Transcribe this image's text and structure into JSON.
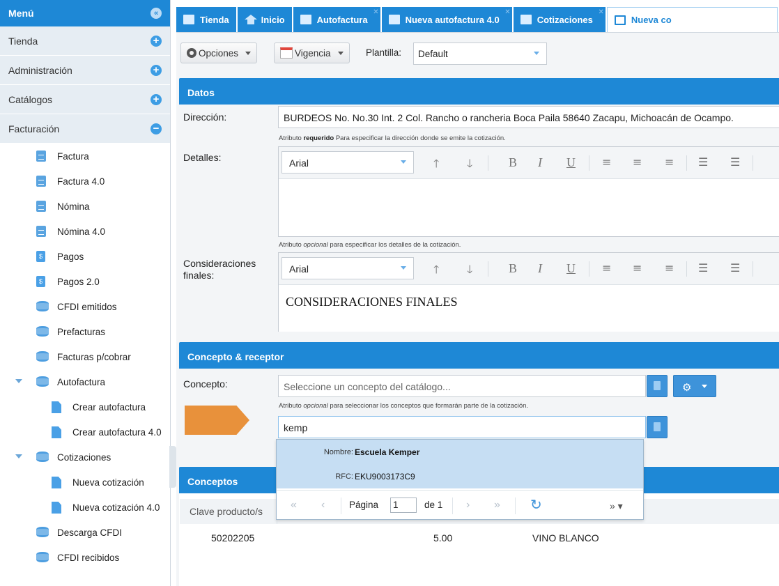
{
  "sidebar": {
    "title": "Menú",
    "sections": [
      {
        "label": "Tienda"
      },
      {
        "label": "Administración"
      },
      {
        "label": "Catálogos"
      },
      {
        "label": "Facturación"
      }
    ],
    "items": [
      {
        "label": "Factura"
      },
      {
        "label": "Factura 4.0"
      },
      {
        "label": "Nómina"
      },
      {
        "label": "Nómina 4.0"
      },
      {
        "label": "Pagos"
      },
      {
        "label": "Pagos 2.0"
      },
      {
        "label": "CFDI emitidos"
      },
      {
        "label": "Prefacturas"
      },
      {
        "label": "Facturas p/cobrar"
      },
      {
        "label": "Autofactura"
      },
      {
        "label": "Crear autofactura"
      },
      {
        "label": "Crear autofactura 4.0"
      },
      {
        "label": "Cotizaciones"
      },
      {
        "label": "Nueva cotización"
      },
      {
        "label": "Nueva cotización 4.0"
      },
      {
        "label": "Descarga CFDI"
      },
      {
        "label": "CFDI recibidos"
      }
    ]
  },
  "tabs": [
    {
      "label": "Tienda"
    },
    {
      "label": "Inicio"
    },
    {
      "label": "Autofactura"
    },
    {
      "label": "Nueva autofactura 4.0"
    },
    {
      "label": "Cotizaciones"
    },
    {
      "label": "Nueva co"
    }
  ],
  "toolbar": {
    "options_label": "Opciones",
    "vigencia_label": "Vigencia",
    "plantilla_label": "Plantilla:",
    "plantilla_value": "Default"
  },
  "datos": {
    "title": "Datos",
    "direccion_label": "Dirección:",
    "direccion_value": "BURDEOS No. No.30 Int. 2 Col. Rancho o rancheria Boca Paila 58640 Zacapu, Michoacán de Ocampo.",
    "direccion_hint_pre": "Atributo ",
    "direccion_hint_bold": "requerido",
    "direccion_hint_post": " Para especificar la dirección donde se emite la cotización.",
    "detalles_label": "Detalles:",
    "detalles_font": "Arial",
    "detalles_hint_pre": "Atributo ",
    "detalles_hint_it": "opcional",
    "detalles_hint_post": " para especificar los detalles de la cotización.",
    "consideraciones_label": "Consideraciones finales:",
    "consideraciones_font": "Arial",
    "consideraciones_content": "CONSIDERACIONES FINALES"
  },
  "concepto": {
    "title": "Concepto & receptor",
    "concepto_label": "Concepto:",
    "concepto_placeholder": "Seleccione un concepto del catálogo...",
    "concepto_hint_pre": "Atributo ",
    "concepto_hint_it": "opcional",
    "concepto_hint_post": " para seleccionar los conceptos que formarán parte de la cotización.",
    "receptor_value": "kemp"
  },
  "dropdown": {
    "nombre_label": "Nombre:",
    "nombre_value": "Escuela Kemper",
    "rfc_label": "RFC:",
    "rfc_value": "EKU9003173C9",
    "page_label": "Página",
    "page_value": "1",
    "page_of": "de 1"
  },
  "conceptos": {
    "title": "Conceptos",
    "columns": [
      "Clave producto/s"
    ],
    "rows": [
      {
        "clave": "50202205",
        "cantidad": "5.00",
        "descripcion": "VINO BLANCO"
      }
    ]
  }
}
